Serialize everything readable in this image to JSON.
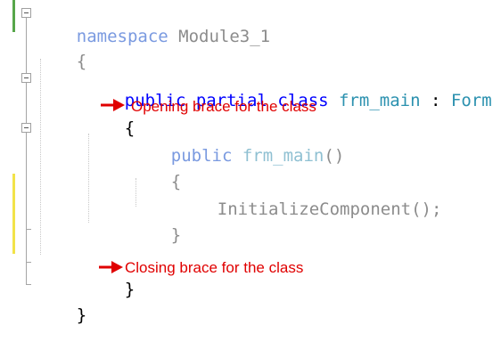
{
  "code": {
    "line1": {
      "keyword": "namespace",
      "name": "Module3_1"
    },
    "line2": {
      "brace": "{"
    },
    "line3": {
      "modifier": "public",
      "modifier2": "partial",
      "kw_class": "class",
      "class_name": "frm_main",
      "colon": ":",
      "base_type": "Form"
    },
    "line4": {
      "brace": "{"
    },
    "line5": {
      "modifier": "public",
      "ctor_name": "frm_main",
      "parens": "()"
    },
    "line6": {
      "brace": "{"
    },
    "line7": {
      "call": "InitializeComponent();"
    },
    "line8": {
      "brace": "}"
    },
    "line10": {
      "brace": "}"
    },
    "line11": {
      "brace": "}"
    }
  },
  "annotations": {
    "opening": "Opening brace for the class",
    "closing": "Closing brace for the class",
    "color": "#e00000"
  },
  "colors": {
    "keyword": "#0000ff",
    "type": "#2b91af",
    "saved_change": "#57a64a",
    "unsaved_change": "#f2e349"
  }
}
